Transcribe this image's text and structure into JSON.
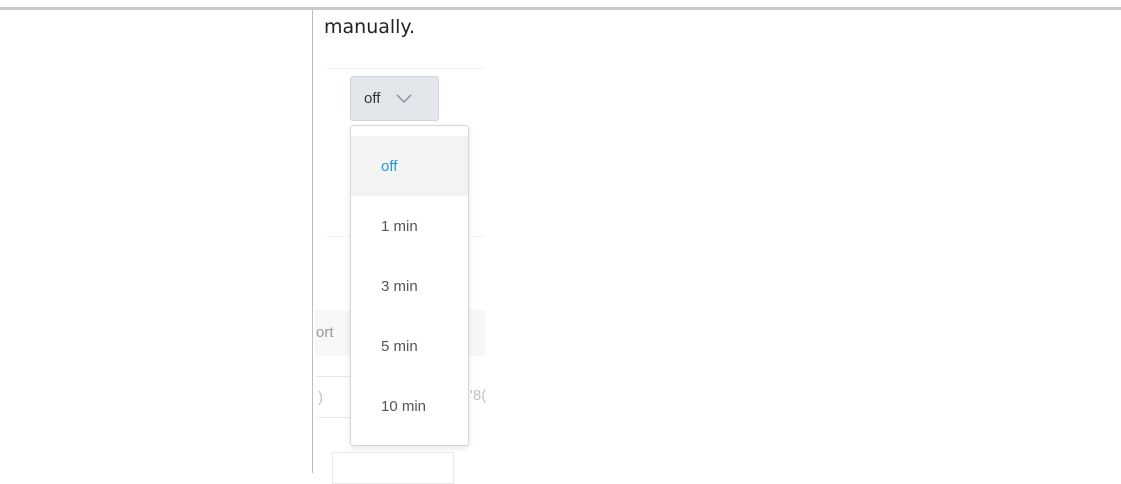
{
  "description_text": "manually.",
  "background_fragments": [
    "ort",
    ")",
    "'8("
  ],
  "select": {
    "value": "off"
  },
  "dropdown": {
    "options": [
      "off",
      "1 min",
      "3 min",
      "5 min",
      "10 min"
    ],
    "selected_index": 0
  },
  "colors": {
    "selected_option": "#1e9bd7",
    "select_bg": "#e3e7ec"
  }
}
